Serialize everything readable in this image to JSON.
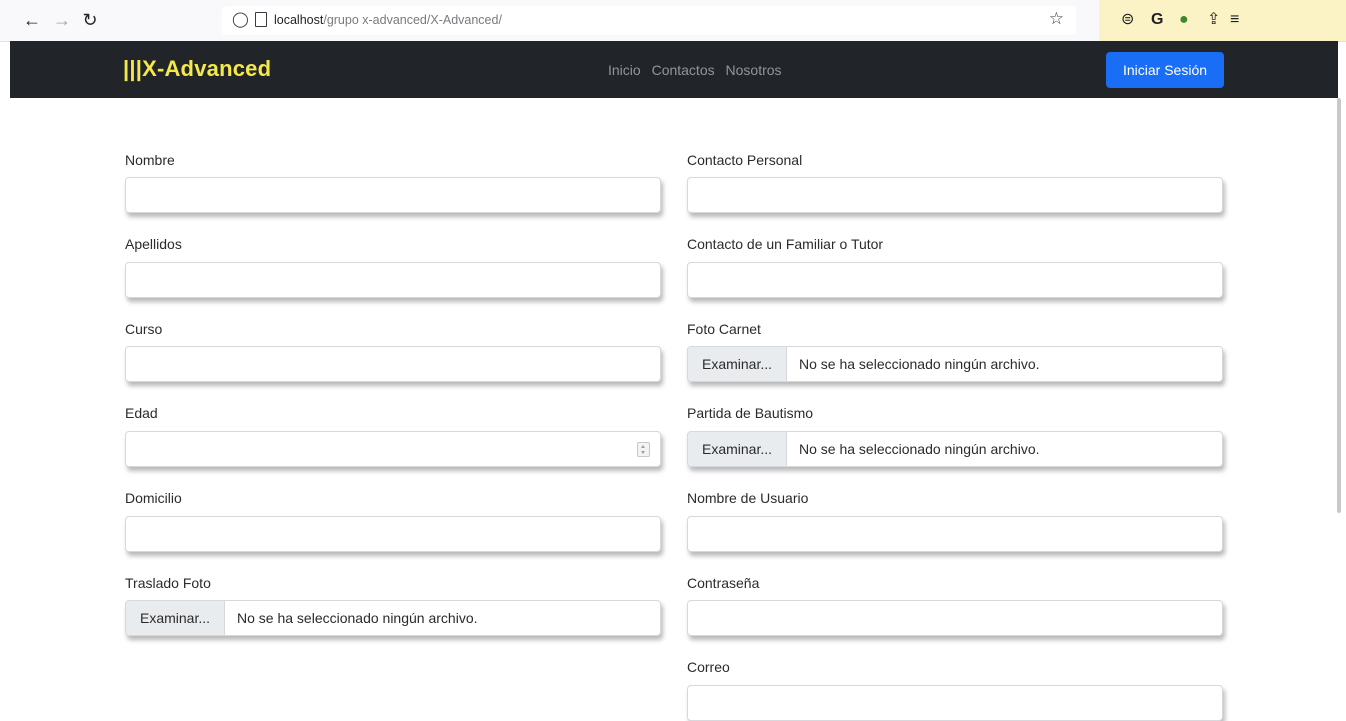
{
  "browser": {
    "url_host": "localhost",
    "url_path": "/grupo x-advanced/X-Advanced/"
  },
  "navbar": {
    "brand": "|||X-Advanced",
    "links": [
      "Inicio",
      "Contactos",
      "Nosotros"
    ],
    "login_label": "Iniciar Sesión"
  },
  "form": {
    "left": {
      "nombre": "Nombre",
      "apellidos": "Apellidos",
      "curso": "Curso",
      "edad": "Edad",
      "domicilio": "Domicilio",
      "traslado_foto": "Traslado Foto"
    },
    "right": {
      "contacto_personal": "Contacto Personal",
      "contacto_familiar": "Contacto de un Familiar o Tutor",
      "foto_carnet": "Foto Carnet",
      "partida_bautismo": "Partida de Bautismo",
      "nombre_usuario": "Nombre de Usuario",
      "contrasena": "Contraseña",
      "correo": "Correo"
    },
    "file_button_label": "Examinar...",
    "file_status": "No se ha seleccionado ningún archivo."
  },
  "colors": {
    "navbar_bg": "#212529",
    "brand": "#f5e84a",
    "primary": "#1a6ef5"
  }
}
